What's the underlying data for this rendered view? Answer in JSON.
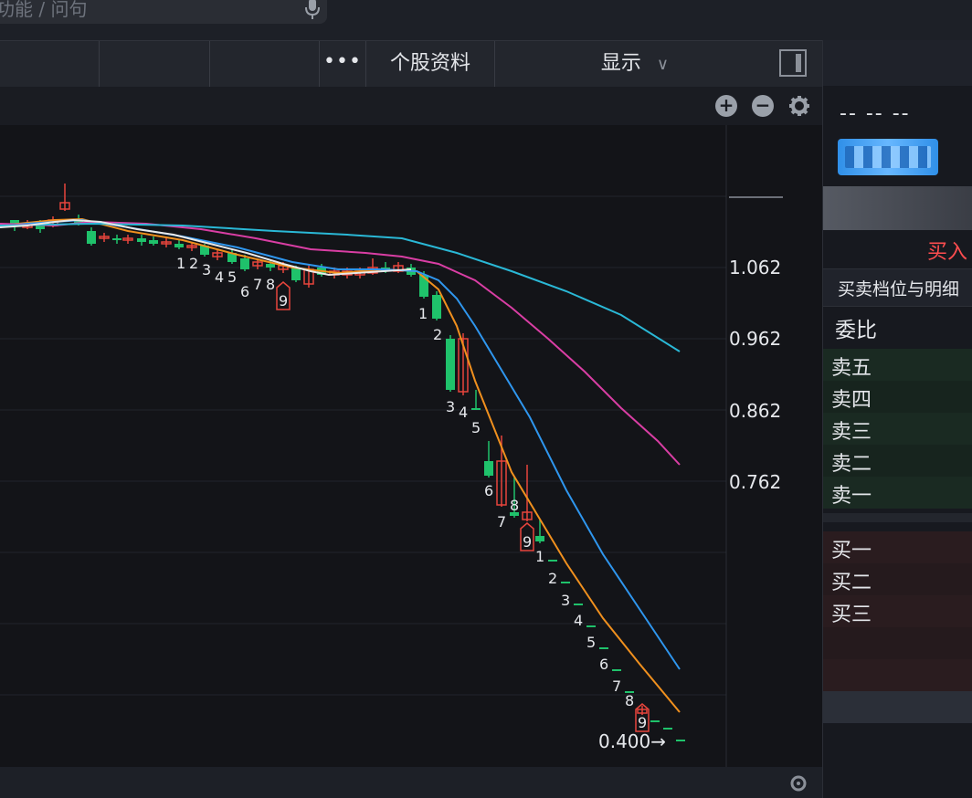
{
  "search": {
    "placeholder": "功能 / 问句"
  },
  "toolbar": {
    "more_label": "•••",
    "stock_info_label": "个股资料",
    "display_label": "显示",
    "display_arrow": "∨"
  },
  "chart_controls": {
    "zoom_in": "+",
    "zoom_out": "−"
  },
  "chart_data": {
    "type": "line",
    "y_ticks": [
      "1.062",
      "0.962",
      "0.862",
      "0.762"
    ],
    "last_price_label": "0.400→",
    "counters_first": [
      "1",
      "2",
      "3",
      "4",
      "5",
      "6",
      "7",
      "8",
      "9"
    ],
    "counters_second": [
      "1",
      "2",
      "3",
      "4",
      "5",
      "6",
      "7",
      "8",
      "9"
    ],
    "counters_third": [
      "1",
      "2",
      "3",
      "4",
      "5",
      "6",
      "7",
      "8",
      "9"
    ],
    "colors": {
      "up": "#e8453c",
      "down": "#1fc26b",
      "ma_white": "#e8e8e8",
      "ma_orange": "#f0901e",
      "ma_blue": "#2f96ee",
      "ma_magenta": "#d93ea4",
      "ma_cyan": "#2ab8d6"
    }
  },
  "right_panel": {
    "header_dash": "-- -- --",
    "buy_label": "买入",
    "tab_label": "买卖档位与明细",
    "weibi_label": "委比",
    "sell_levels": [
      "卖五",
      "卖四",
      "卖三",
      "卖二",
      "卖一"
    ],
    "buy_levels": [
      "买一",
      "买二",
      "买三"
    ]
  }
}
